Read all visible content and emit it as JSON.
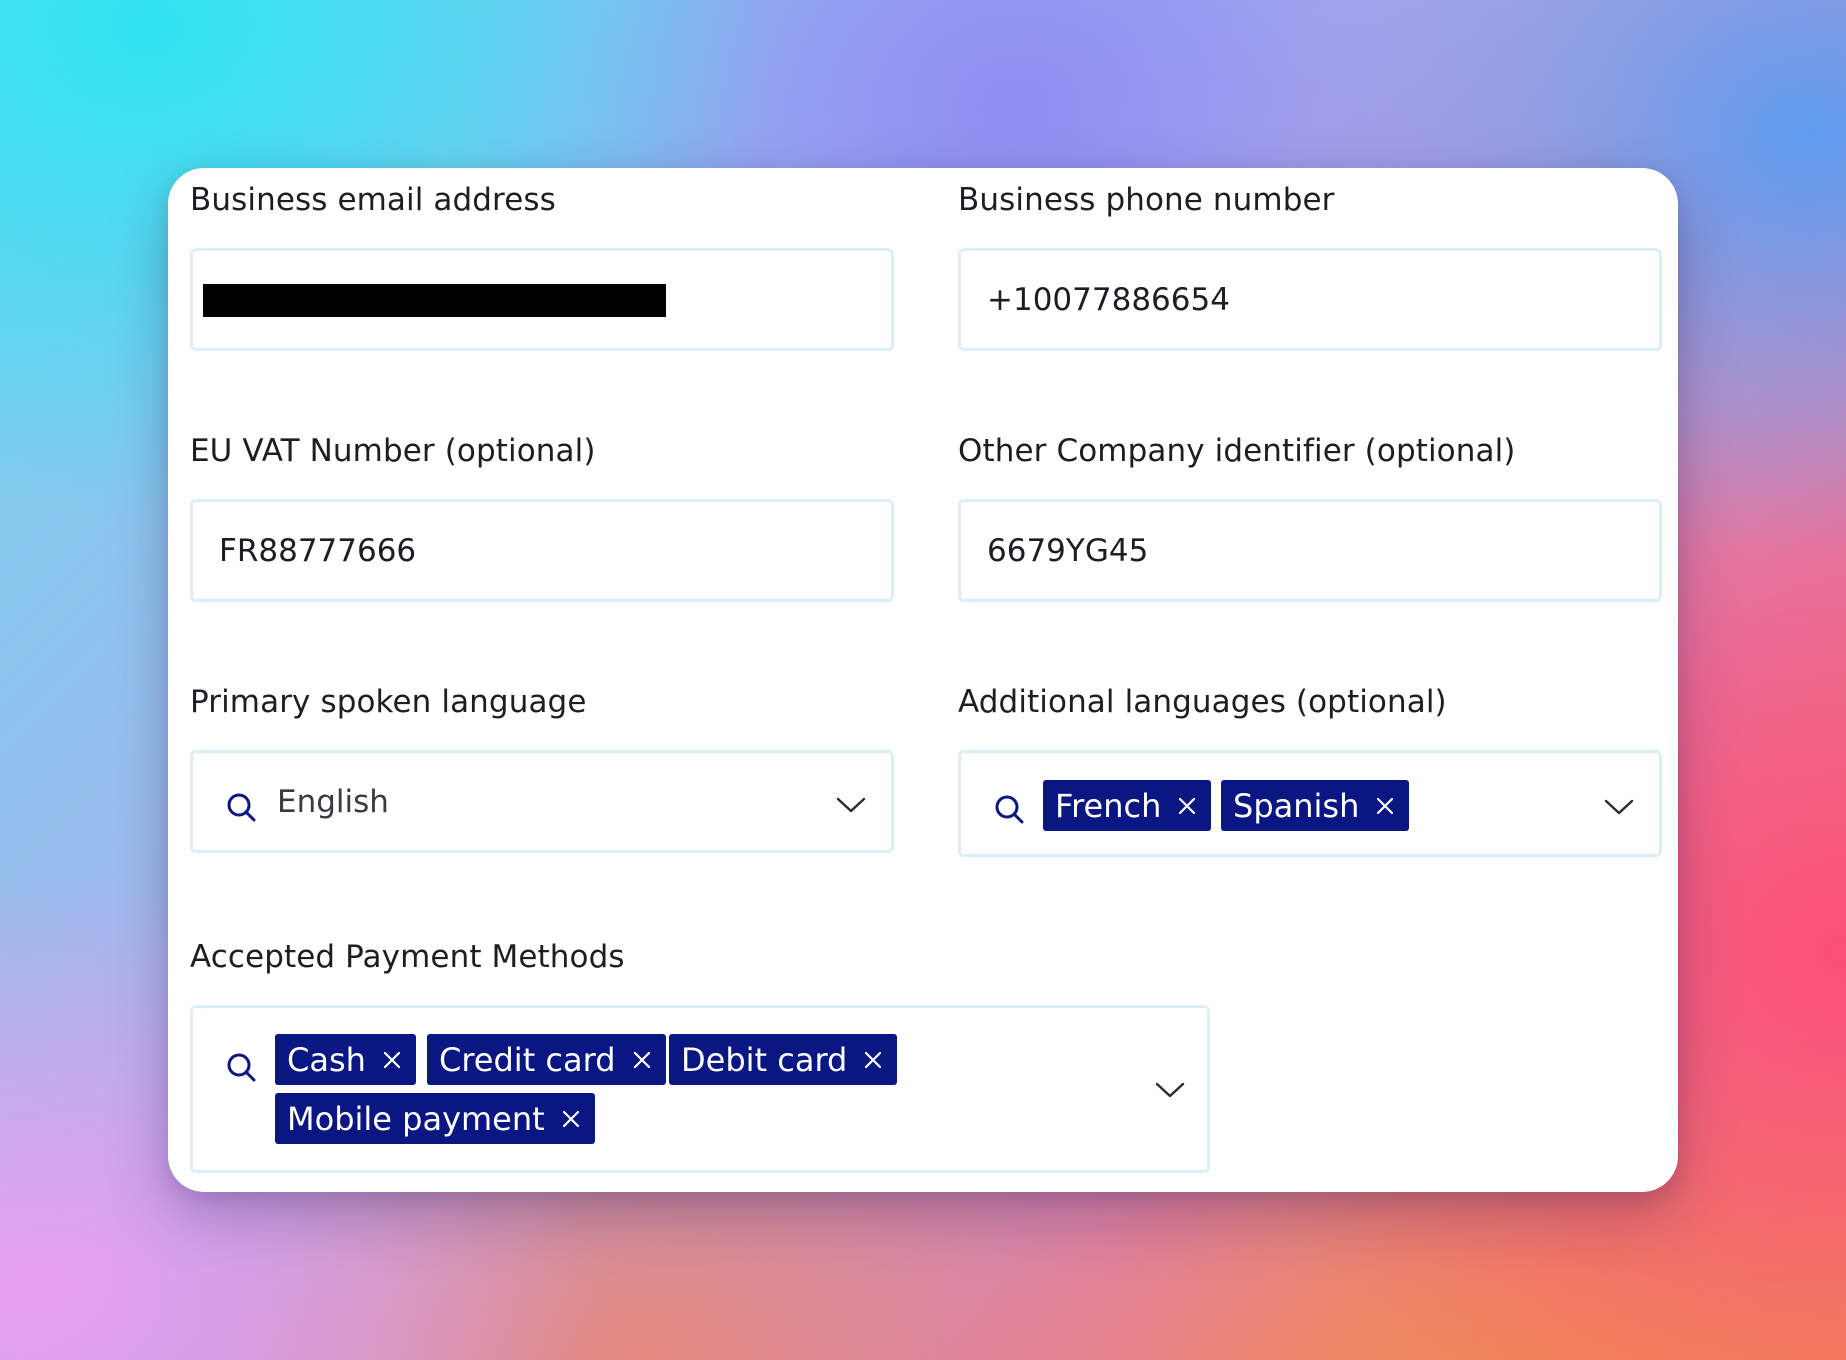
{
  "form": {
    "email": {
      "label": "Business email address",
      "value": ""
    },
    "phone": {
      "label": "Business phone number",
      "value": "+10077886654"
    },
    "vat": {
      "label": "EU VAT Number (optional)",
      "value": "FR88777666"
    },
    "company_id": {
      "label": "Other Company identifier (optional)",
      "value": "6679YG45"
    },
    "primary_language": {
      "label": "Primary spoken language",
      "value": "English",
      "icon": "search-icon"
    },
    "additional_languages": {
      "label": "Additional languages (optional)",
      "chips": [
        "French",
        "Spanish"
      ],
      "icon": "search-icon"
    },
    "payment_methods": {
      "label": "Accepted Payment Methods",
      "chips": [
        "Cash",
        "Credit card",
        "Debit card",
        "Mobile payment"
      ],
      "icon": "search-icon"
    }
  },
  "colors": {
    "chip_bg": "#0a1782",
    "chip_text": "#ffffff",
    "field_border": "#dceef6",
    "icon": "#0a1782"
  }
}
